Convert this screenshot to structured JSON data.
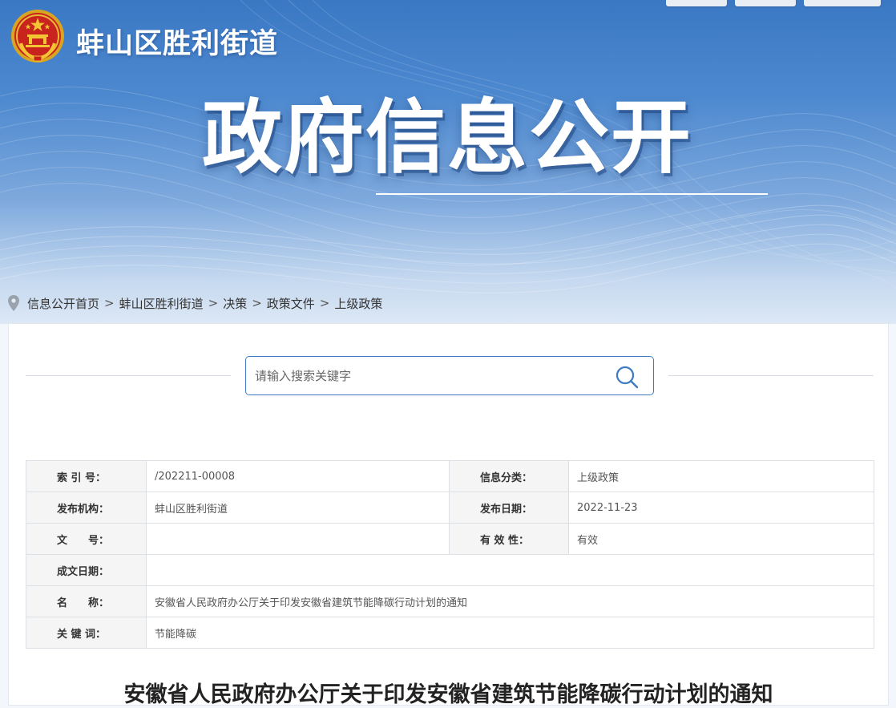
{
  "site": {
    "title": "蚌山区胜利街道",
    "banner_title": "政府信息公开"
  },
  "breadcrumb": [
    "信息公开首页",
    "蚌山区胜利街道",
    "决策",
    "政策文件",
    "上级政策"
  ],
  "breadcrumb_separator": ">",
  "search": {
    "placeholder": "请输入搜索关键字",
    "value": ""
  },
  "info": {
    "index_no": {
      "label": "索 引 号：",
      "value": "/202211-00008"
    },
    "category": {
      "label": "信息分类：",
      "value": "上级政策"
    },
    "publisher": {
      "label": "发布机构：",
      "value": "蚌山区胜利街道"
    },
    "publish_date": {
      "label": "发布日期：",
      "value": "2022-11-23"
    },
    "doc_no": {
      "label": "文　　号：",
      "value": ""
    },
    "validity": {
      "label": "有 效 性：",
      "value": "有效"
    },
    "created_date": {
      "label": "成文日期：",
      "value": ""
    },
    "name": {
      "label": "名　　称：",
      "value": "安徽省人民政府办公厅关于印发安徽省建筑节能降碳行动计划的通知"
    },
    "keywords": {
      "label": "关 键 词：",
      "value": "节能降碳"
    }
  },
  "document": {
    "title": "安徽省人民政府办公厅关于印发安徽省建筑节能降碳行动计划的通知"
  },
  "colors": {
    "banner_top": "#3b78c4",
    "banner_bottom": "#dde8f5",
    "accent": "#3e7bc2",
    "label_bg": "#f5f5f5"
  },
  "icons": {
    "emblem": "national-emblem-icon",
    "breadcrumb": "location-pin-icon",
    "search": "search-icon"
  }
}
